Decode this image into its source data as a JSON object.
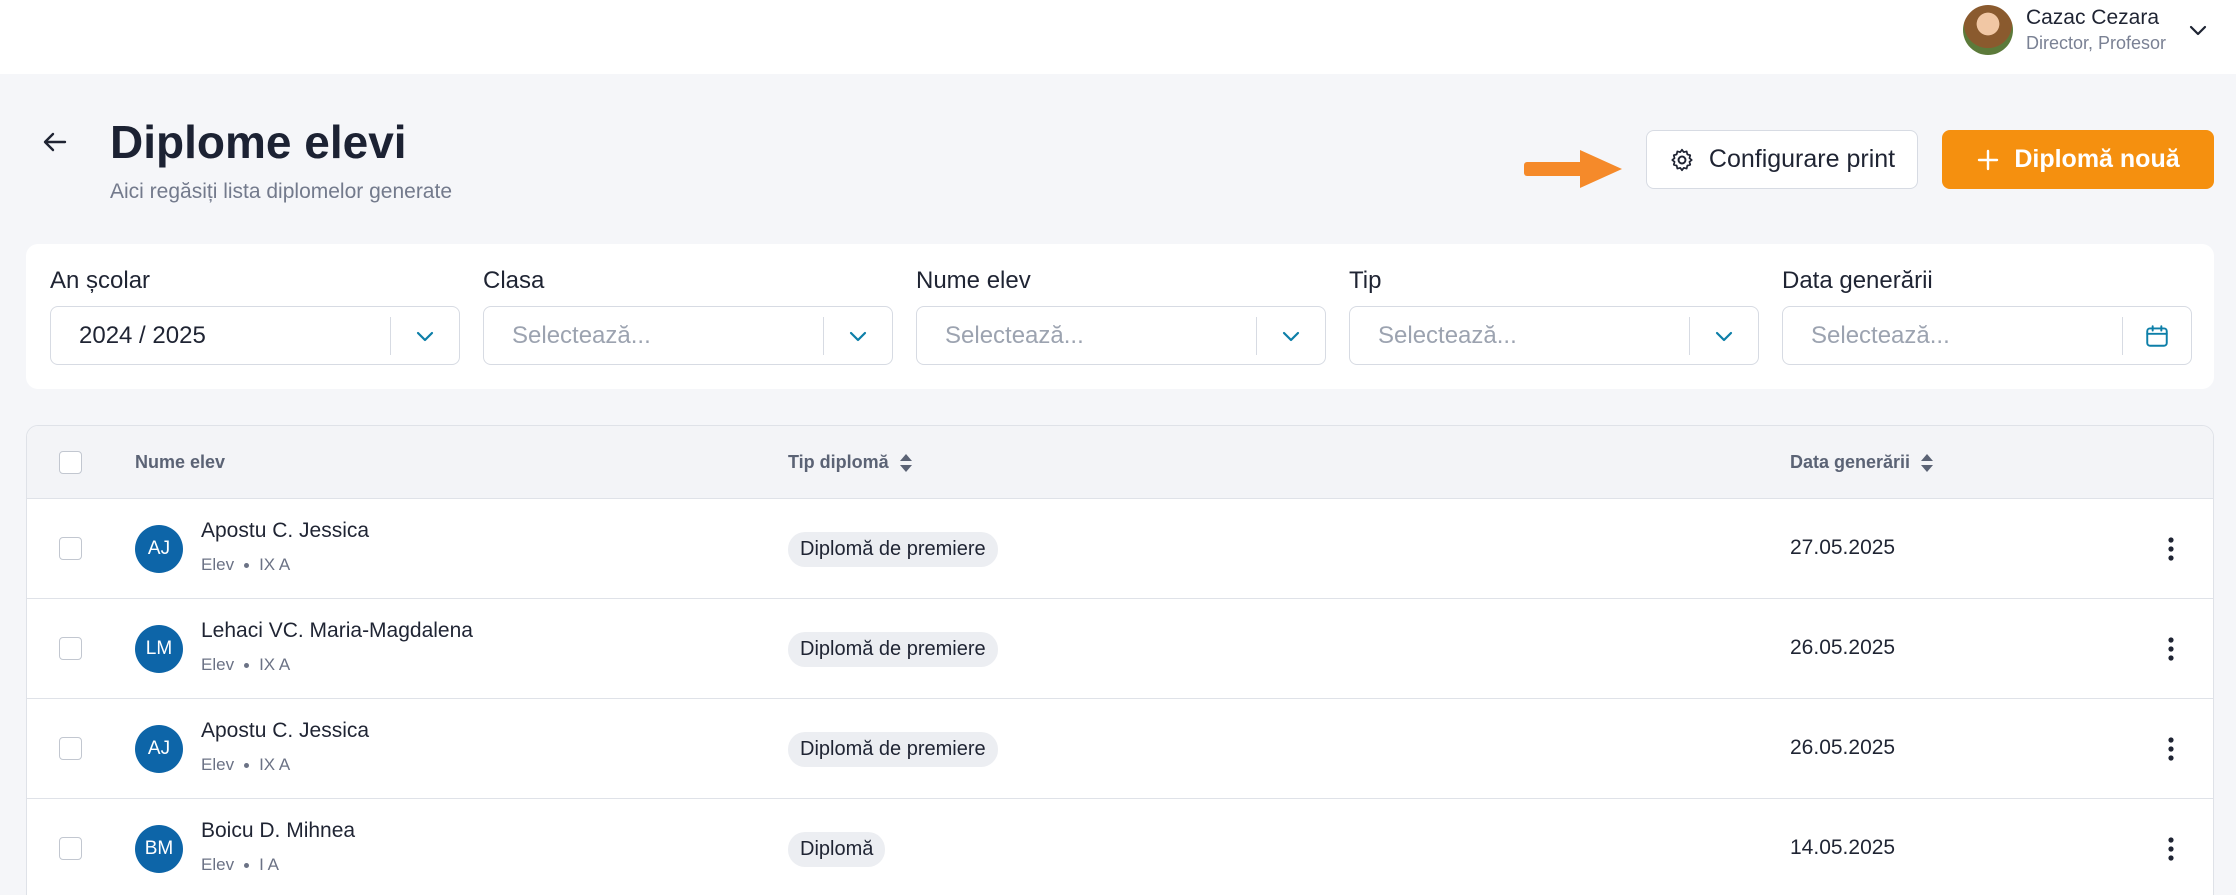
{
  "user": {
    "name": "Cazac Cezara",
    "role": "Director, Profesor"
  },
  "header": {
    "title": "Diplome elevi",
    "subtitle": "Aici regăsiți lista diplomelor generate",
    "config_label": "Configurare print",
    "new_label": "Diplomă nouă"
  },
  "filters": [
    {
      "label": "An școlar",
      "value": "2024 / 2025",
      "placeholder": false,
      "indicator": "chevron-down-icon"
    },
    {
      "label": "Clasa",
      "value": "Selectează...",
      "placeholder": true,
      "indicator": "chevron-down-icon"
    },
    {
      "label": "Nume elev",
      "value": "Selectează...",
      "placeholder": true,
      "indicator": "chevron-down-icon"
    },
    {
      "label": "Tip",
      "value": "Selectează...",
      "placeholder": true,
      "indicator": "chevron-down-icon"
    },
    {
      "label": "Data generării",
      "value": "Selectează...",
      "placeholder": true,
      "indicator": "calendar-icon"
    }
  ],
  "table": {
    "columns": {
      "name": "Nume elev",
      "type": "Tip diplomă",
      "date": "Data generării"
    },
    "rows": [
      {
        "initials": "AJ",
        "name": "Apostu C. Jessica",
        "role": "Elev",
        "class": "IX A",
        "type": "Diplomă de premiere",
        "date": "27.05.2025"
      },
      {
        "initials": "LM",
        "name": "Lehaci VC. Maria-Magdalena",
        "role": "Elev",
        "class": "IX A",
        "type": "Diplomă de premiere",
        "date": "26.05.2025"
      },
      {
        "initials": "AJ",
        "name": "Apostu C. Jessica",
        "role": "Elev",
        "class": "IX A",
        "type": "Diplomă de premiere",
        "date": "26.05.2025"
      },
      {
        "initials": "BM",
        "name": "Boicu D. Mihnea",
        "role": "Elev",
        "class": "I A",
        "type": "Diplomă",
        "date": "14.05.2025"
      }
    ]
  },
  "colors": {
    "accent": "#f5900f",
    "avatar": "#0d65a8",
    "indicator": "#0d7fa8"
  }
}
